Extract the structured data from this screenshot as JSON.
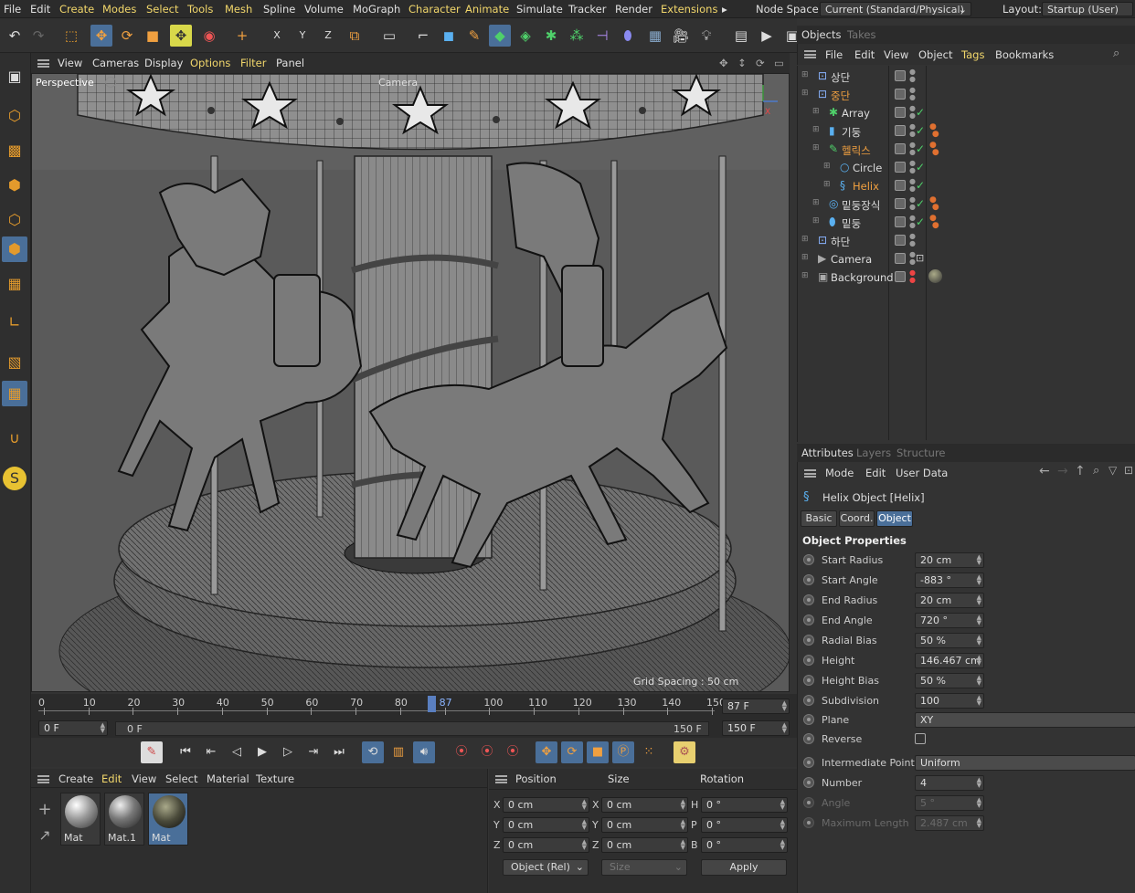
{
  "menu": {
    "items": [
      "File",
      "Edit",
      "Create",
      "Modes",
      "Select",
      "Tools",
      "Mesh",
      "Spline",
      "Volume",
      "MoGraph",
      "Character",
      "Animate",
      "Simulate",
      "Tracker",
      "Render",
      "Extensions"
    ],
    "more": "▸",
    "node_space_label": "Node Space:",
    "node_space_value": "Current (Standard/Physical)",
    "layout_label": "Layout:",
    "layout_value": "Startup (User)"
  },
  "viewport": {
    "menu": [
      "View",
      "Cameras",
      "Display",
      "Options",
      "Filter",
      "Panel"
    ],
    "label": "Perspective",
    "camera_label": "Camera",
    "grid_spacing": "Grid Spacing : 50 cm"
  },
  "timeline": {
    "ticks": [
      "0",
      "10",
      "20",
      "30",
      "40",
      "50",
      "60",
      "70",
      "80",
      "87",
      "100",
      "110",
      "120",
      "130",
      "140",
      "150"
    ],
    "current_frame": "87 F",
    "start": "0 F",
    "range_start": "0 F",
    "range_end": "150 F",
    "end": "150 F",
    "current_fraction": 0.58
  },
  "material_manager": {
    "menu": [
      "Create",
      "Edit",
      "View",
      "Select",
      "Material",
      "Texture"
    ],
    "materials": [
      {
        "name": "Mat"
      },
      {
        "name": "Mat.1"
      },
      {
        "name": "Mat"
      }
    ]
  },
  "coord_manager": {
    "headers": {
      "position": "Position",
      "size": "Size",
      "rotation": "Rotation"
    },
    "rows": [
      {
        "axis": "X",
        "pos": "0 cm",
        "saxis": "X",
        "size": "0 cm",
        "raxis": "H",
        "rot": "0 °"
      },
      {
        "axis": "Y",
        "pos": "0 cm",
        "saxis": "Y",
        "size": "0 cm",
        "raxis": "P",
        "rot": "0 °"
      },
      {
        "axis": "Z",
        "pos": "0 cm",
        "saxis": "Z",
        "size": "0 cm",
        "raxis": "B",
        "rot": "0 °"
      }
    ],
    "mode": "Object (Rel)",
    "size_mode": "Size",
    "apply": "Apply"
  },
  "objects_panel": {
    "tabs": [
      "Objects",
      "Takes"
    ],
    "menu": [
      "File",
      "Edit",
      "View",
      "Object",
      "Tags",
      "Bookmarks"
    ],
    "items": [
      {
        "name": "상단",
        "indent": 0,
        "orange": false
      },
      {
        "name": "중단",
        "indent": 0,
        "orange": true
      },
      {
        "name": "Array",
        "indent": 1,
        "orange": false
      },
      {
        "name": "기둥",
        "indent": 1,
        "orange": false
      },
      {
        "name": "헬릭스",
        "indent": 1,
        "orange": true
      },
      {
        "name": "Circle",
        "indent": 2,
        "orange": false
      },
      {
        "name": "Helix",
        "indent": 2,
        "orange": true
      },
      {
        "name": "밑둥장식",
        "indent": 1,
        "orange": false
      },
      {
        "name": "밑둥",
        "indent": 1,
        "orange": false
      },
      {
        "name": "하단",
        "indent": 0,
        "orange": false
      },
      {
        "name": "Camera",
        "indent": 0,
        "orange": false
      },
      {
        "name": "Background",
        "indent": 0,
        "orange": false
      }
    ]
  },
  "attributes": {
    "tabs": [
      "Attributes",
      "Layers",
      "Structure"
    ],
    "menu": [
      "Mode",
      "Edit",
      "User Data"
    ],
    "object_title": "Helix Object [Helix]",
    "subtabs": [
      "Basic",
      "Coord.",
      "Object"
    ],
    "section": "Object Properties",
    "props": [
      {
        "name": "Start Radius",
        "value": "20 cm"
      },
      {
        "name": "Start Angle",
        "value": "-883 °"
      },
      {
        "name": "End Radius",
        "value": "20 cm"
      },
      {
        "name": "End Angle",
        "value": "720 °"
      },
      {
        "name": "Radial Bias",
        "value": "50 %"
      },
      {
        "name": "Height",
        "value": "146.467 cm"
      },
      {
        "name": "Height Bias",
        "value": "50 %"
      },
      {
        "name": "Subdivision",
        "value": "100"
      },
      {
        "name": "Plane",
        "value": "XY"
      },
      {
        "name": "Reverse",
        "value": ""
      }
    ],
    "interp": [
      {
        "name": "Intermediate Points",
        "value": "Uniform"
      },
      {
        "name": "Number",
        "value": "4"
      },
      {
        "name": "Angle",
        "value": "5 °"
      },
      {
        "name": "Maximum Length",
        "value": "2.487 cm"
      }
    ]
  },
  "colors": {
    "accent": "#4a6f99",
    "highlight": "#f2d76b",
    "orange": "#f0a040"
  }
}
